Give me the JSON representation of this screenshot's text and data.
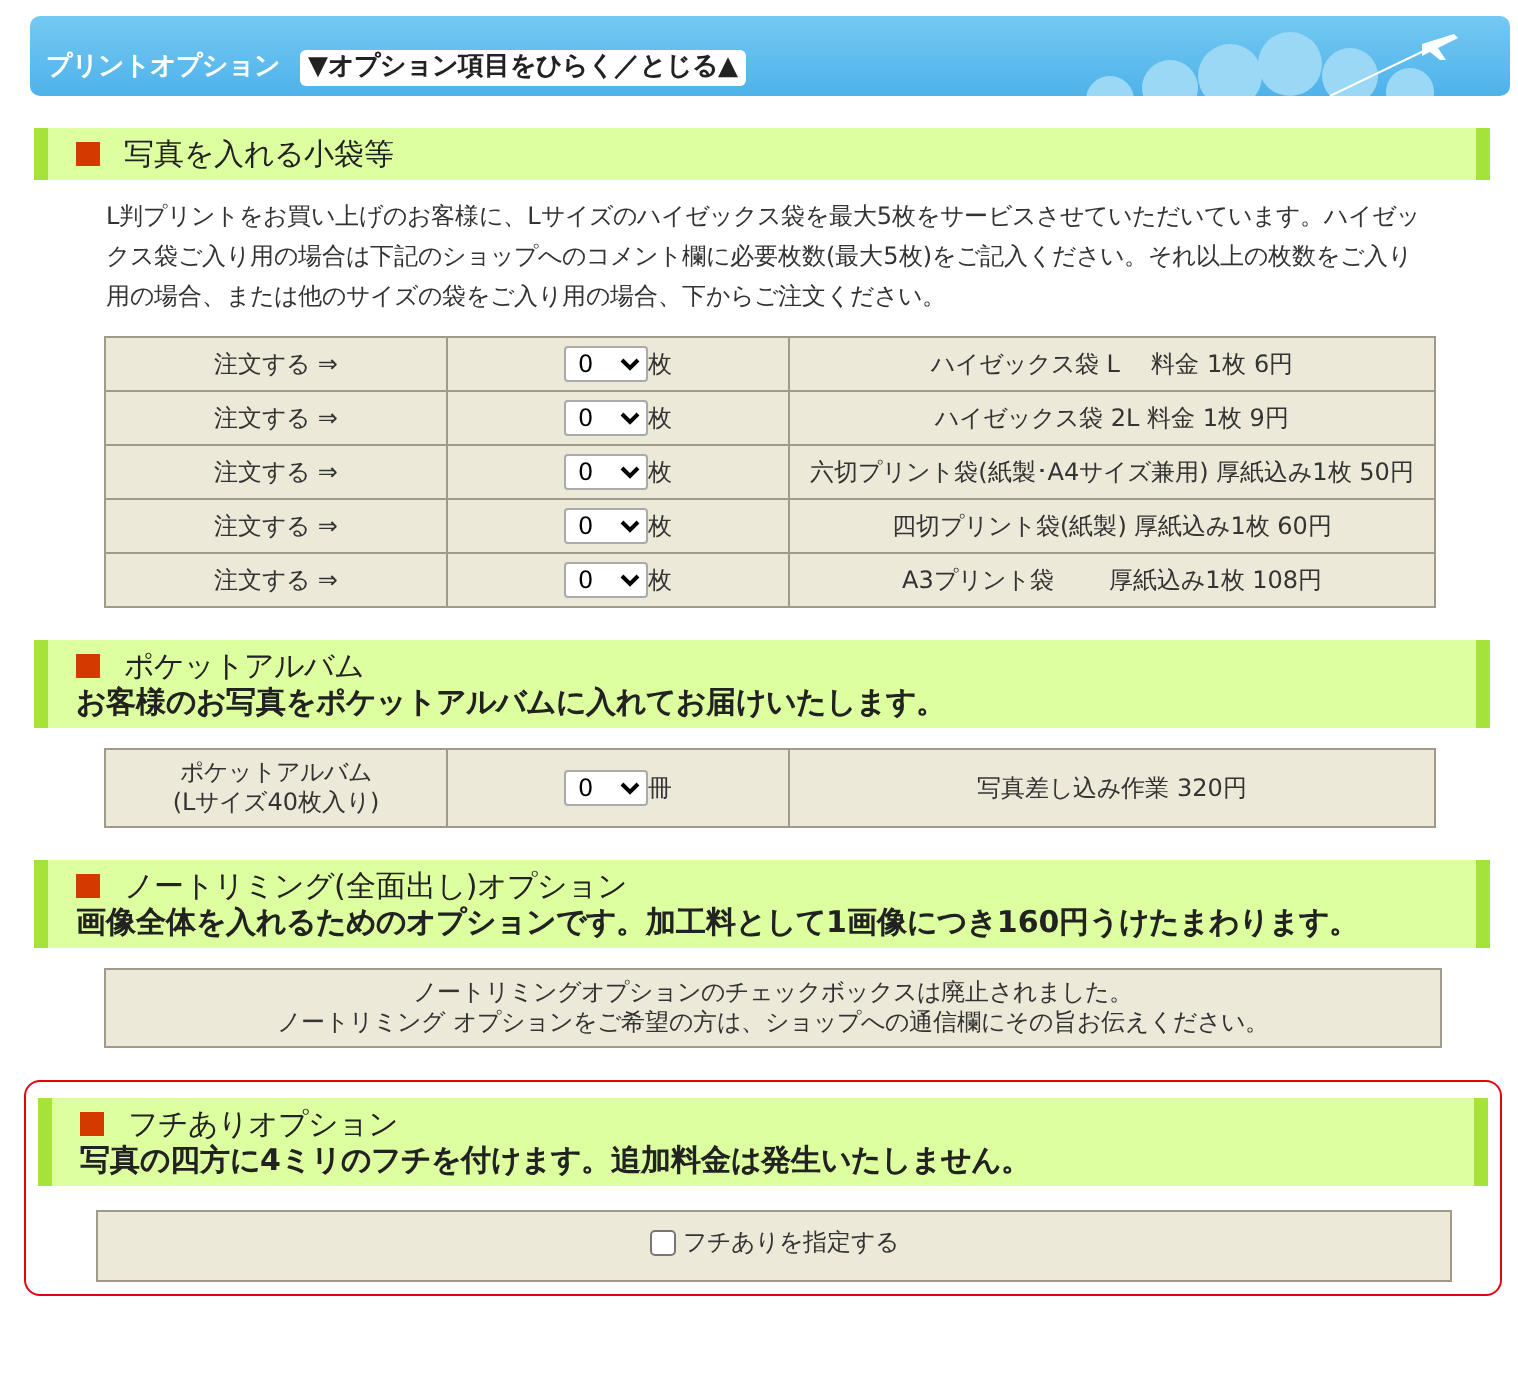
{
  "header": {
    "title": "プリントオプション",
    "toggle": "▼オプション項目をひらく／とじる▲"
  },
  "sections": [
    {
      "kind": "table",
      "highlighted": false,
      "title": "写真を入れる小袋等",
      "description": "L判プリントをお買い上げのお客様に、Lサイズのハイゼックス袋を最大5枚をサービスさせていただいています。ハイゼックス袋ご入り用の場合は下記のショップへのコメント欄に必要枚数(最大5枚)をご記入ください。それ以上の枚数をご入り用の場合、または他のサイズの袋をご入り用の場合、下からご注文ください。",
      "rows": [
        {
          "label": "注文する ⇒",
          "value": "0",
          "unit": "枚",
          "item": "ハイゼックス袋 L　 料金 1枚 6円"
        },
        {
          "label": "注文する ⇒",
          "value": "0",
          "unit": "枚",
          "item": "ハイゼックス袋 2L 料金 1枚 9円"
        },
        {
          "label": "注文する ⇒",
          "value": "0",
          "unit": "枚",
          "item": "六切プリント袋(紙製･A4サイズ兼用) 厚紙込み1枚 50円"
        },
        {
          "label": "注文する ⇒",
          "value": "0",
          "unit": "枚",
          "item": "四切プリント袋(紙製) 厚紙込み1枚 60円"
        },
        {
          "label": "注文する ⇒",
          "value": "0",
          "unit": "枚",
          "item": "A3プリント袋　　 厚紙込み1枚 108円"
        }
      ]
    },
    {
      "kind": "table",
      "highlighted": false,
      "title": "ポケットアルバム",
      "subtitle": "お客様のお写真をポケットアルバムに入れてお届けいたします。",
      "rows": [
        {
          "label": "ポケットアルバム\n(Lサイズ40枚入り)",
          "value": "0",
          "unit": "冊",
          "item": "写真差し込み作業 320円"
        }
      ]
    },
    {
      "kind": "notice",
      "highlighted": false,
      "title": "ノートリミング(全面出し)オプション",
      "subtitle": "画像全体を入れるためのオプションです。加工料として1画像につき160円うけたまわります。",
      "lines": [
        "ノートリミングオプションのチェックボックスは廃止されました。",
        "ノートリミング オプションをご希望の方は、ショップへの通信欄にその旨お伝えください。"
      ]
    },
    {
      "kind": "checkbox",
      "highlighted": true,
      "title": "フチありオプション",
      "subtitle": "写真の四方に4ミリのフチを付けます。追加料金は発生いたしません。",
      "checkbox": {
        "label": "フチありを指定する",
        "checked": false
      }
    }
  ]
}
